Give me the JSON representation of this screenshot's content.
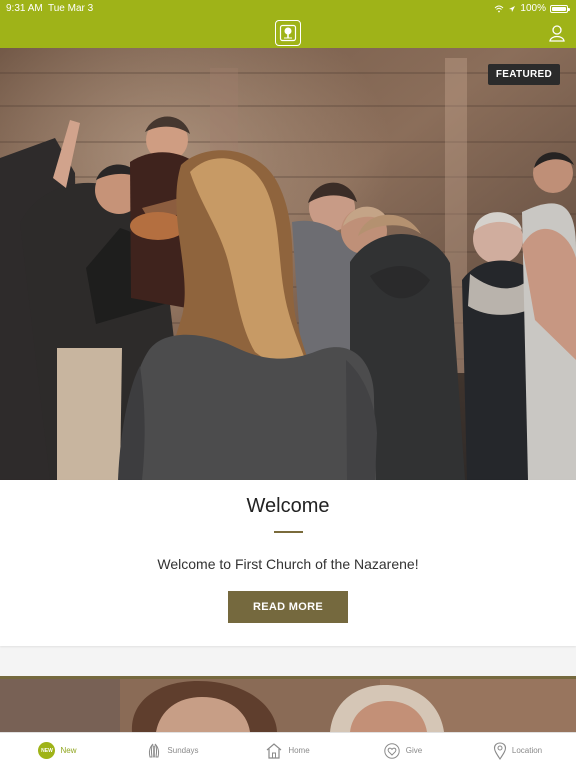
{
  "status_bar": {
    "time": "9:31 AM",
    "date": "Tue Mar 3",
    "battery": "100%"
  },
  "header": {
    "logo_icon": "church-logo-icon",
    "profile_icon": "profile-icon"
  },
  "featured": {
    "badge": "FEATURED",
    "title": "Welcome",
    "description": "Welcome to First Church of the Nazarene!",
    "button": "READ MORE"
  },
  "tabs": [
    {
      "label": "New",
      "icon": "new-icon",
      "badge": "NEW"
    },
    {
      "label": "Sundays",
      "icon": "praying-hands-icon"
    },
    {
      "label": "Home",
      "icon": "home-icon"
    },
    {
      "label": "Give",
      "icon": "heart-icon"
    },
    {
      "label": "Location",
      "icon": "location-pin-icon"
    }
  ],
  "colors": {
    "header": "#9fb318",
    "accent": "#75693e",
    "active_tab": "#8fa51e",
    "inactive_tab": "#8a8a8a"
  }
}
